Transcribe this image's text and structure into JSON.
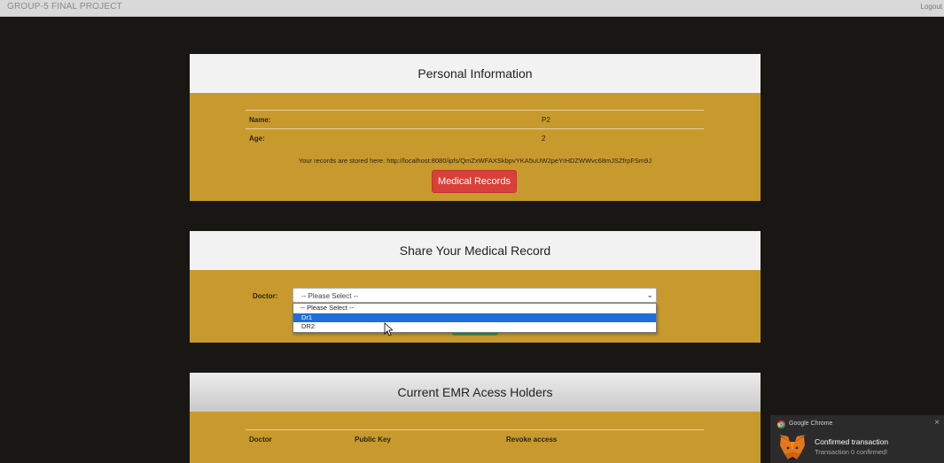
{
  "navbar": {
    "brand": "GROUP-5 FINAL PROJECT",
    "logout": "Logout"
  },
  "personal": {
    "title": "Personal Information",
    "rows": [
      {
        "key": "Name:",
        "value": "P2"
      },
      {
        "key": "Age:",
        "value": "2"
      }
    ],
    "stored_text": "Your records are stored here: http://localhost:8080/ipfs/QmZxWFAXSkbpvYKA5uUW2peYrHDZWWvc68mJSZfrpFSm9J",
    "button_label": "Medical Records"
  },
  "share": {
    "title": "Share Your Medical Record",
    "doctor_label": "Doctor:",
    "selected": "-- Please Select --",
    "options": [
      "-- Please Select --",
      "Dr1",
      "DR2"
    ],
    "highlighted_index": 1
  },
  "emr": {
    "title": "Current EMR Acess Holders",
    "columns": [
      "Doctor",
      "Public Key",
      "Revoke access"
    ]
  },
  "notification": {
    "app": "Google Chrome",
    "title": "Confirmed transaction",
    "body": "Transaction 0 confirmed!"
  },
  "colors": {
    "panel": "#c89a2d",
    "background": "#191713",
    "danger": "#d9403a",
    "highlight": "#1e6fd9"
  }
}
